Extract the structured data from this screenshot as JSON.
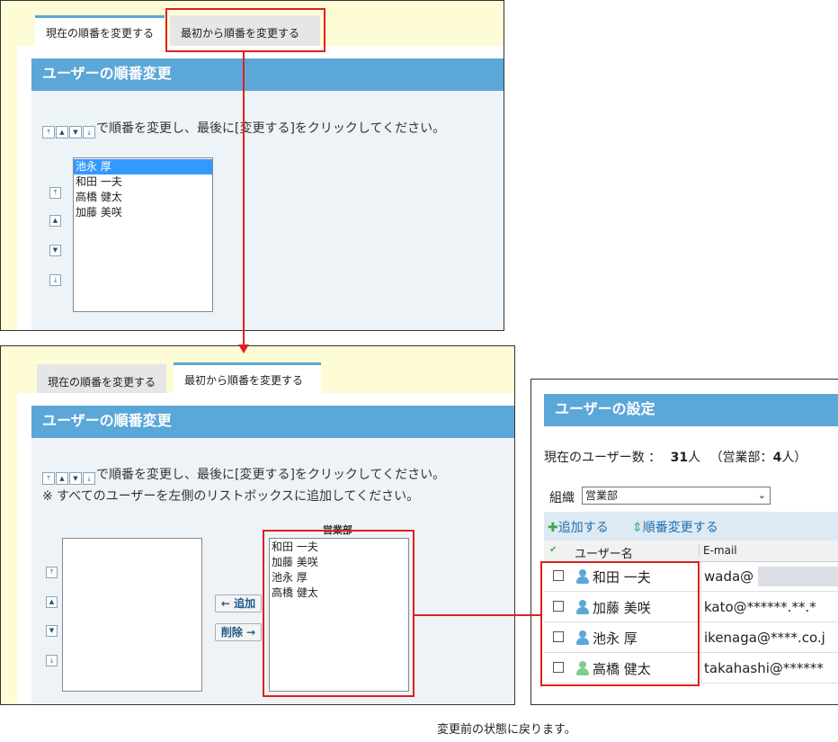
{
  "tabs": {
    "current_order": "現在の順番を変更する",
    "from_start": "最初から順番を変更する"
  },
  "panel_title": "ユーザーの順番変更",
  "instruction": "で順番を変更し、最後に[変更する]をクリックしてください。",
  "note": "※ すべてのユーザーを左側のリストボックスに追加してください。",
  "order_icons": [
    "⤒",
    "▲",
    "▼",
    "⤓"
  ],
  "top_panel": {
    "list_items": [
      "池永 厚",
      "和田 一夫",
      "高橋 健太",
      "加藤 美咲"
    ],
    "selected_index": 0
  },
  "mid_panel": {
    "group_label": "営業部",
    "add_button": "← 追加",
    "remove_button": "削除 →",
    "right_list": [
      "和田 一夫",
      "加藤 美咲",
      "池永 厚",
      "高橋 健太"
    ]
  },
  "settings": {
    "title": "ユーザーの設定",
    "count_prefix": "現在のユーザー数 ：",
    "count_value": "31",
    "count_unit": "人",
    "dept_prefix": "（営業部：",
    "dept_value": "4",
    "dept_suffix": "人）",
    "org_label": "組織",
    "org_select": "営業部",
    "add_link": "追加する",
    "reorder_link": "順番変更する",
    "col_user": "ユーザー名",
    "col_email": "E-mail",
    "rows": [
      {
        "name": "和田 一夫",
        "email": "wada@",
        "icon_color": "#5ba7d8"
      },
      {
        "name": "加藤 美咲",
        "email": "kato@******.**.*",
        "icon_color": "#5ba7d8"
      },
      {
        "name": "池永 厚",
        "email": "ikenaga@****.co.j",
        "icon_color": "#5ba7d8"
      },
      {
        "name": "高橋 健太",
        "email": "takahashi@******",
        "icon_color": "#7ccf8a"
      }
    ]
  },
  "caption": "変更前の状態に戻ります。",
  "colors": {
    "accent": "#5ba7d8",
    "annotation": "#e02020",
    "panel_bg": "#eef3f7",
    "tab_bg": "#fefcd6"
  }
}
